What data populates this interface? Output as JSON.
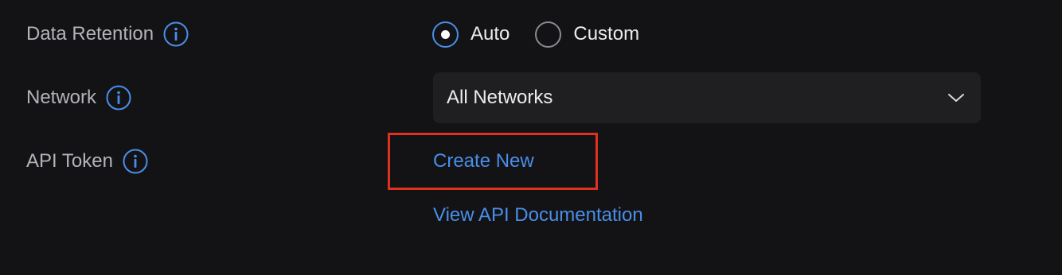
{
  "settings": {
    "data_retention": {
      "label": "Data Retention",
      "info_icon": "info-icon",
      "options": [
        {
          "label": "Auto",
          "selected": true
        },
        {
          "label": "Custom",
          "selected": false
        }
      ]
    },
    "network": {
      "label": "Network",
      "info_icon": "info-icon",
      "selected_value": "All Networks",
      "dropdown_icon": "chevron-down-icon"
    },
    "api_token": {
      "label": "API Token",
      "info_icon": "info-icon",
      "create_link": "Create New",
      "docs_link": "View API Documentation"
    }
  },
  "colors": {
    "background": "#131316",
    "accent": "#4a8ee8",
    "highlight": "#e0301e",
    "label_text": "#b3b3ba",
    "field_background": "#1f1f22"
  }
}
